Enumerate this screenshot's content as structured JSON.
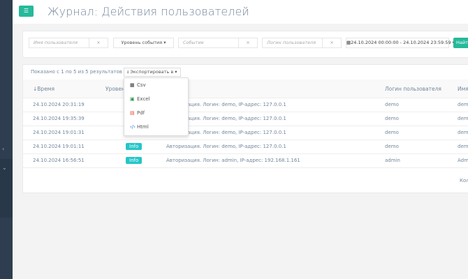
{
  "header": {
    "title": "Журнал: Действия пользователей",
    "menu_icon": "hamburger-icon"
  },
  "filters": {
    "username_placeholder": "Имя пользователя",
    "clear_label": "×",
    "event_level_label": "Уровень события ▾",
    "event_placeholder": "Событие",
    "login_placeholder": "Логин пользователя",
    "date_range": "24.10.2024 00:00:00 - 24.10.2024 23:59:59 ▾",
    "find_label": "Найти"
  },
  "results": {
    "summary": "Показано с 1 по 5 из 5 результатов",
    "export_label": "Экспортировать в ▾",
    "export_menu": [
      {
        "label": "Csv",
        "icon": "table-icon"
      },
      {
        "label": "Excel",
        "icon": "file-excel-icon"
      },
      {
        "label": "Pdf",
        "icon": "file-pdf-icon"
      },
      {
        "label": "Html",
        "icon": "code-icon"
      }
    ],
    "columns": [
      "↓Время",
      "Уровень",
      "Логин пользователя",
      "Имя"
    ],
    "rows": [
      {
        "time": "24.10.2024 20:31:19",
        "level": "",
        "event": "Авторизация. Логин: demo, IP-адрес: 127.0.0.1",
        "login": "demo",
        "name": "demo"
      },
      {
        "time": "24.10.2024 19:35:39",
        "level": "",
        "event": "Авторизация. Логин: demo, IP-адрес: 127.0.0.1",
        "login": "demo",
        "name": "demo"
      },
      {
        "time": "24.10.2024 19:01:31",
        "level": "",
        "event": "Авторизация. Логин: demo, IP-адрес: 127.0.0.1",
        "login": "demo",
        "name": "demo"
      },
      {
        "time": "24.10.2024 19:01:11",
        "level": "Info",
        "event": "Авторизация. Логин: demo, IP-адрес: 127.0.0.1",
        "login": "demo",
        "name": "demo"
      },
      {
        "time": "24.10.2024 16:56:51",
        "level": "Info",
        "event": "Авторизация. Логин: admin, IP-адрес: 192.168.1.161",
        "login": "admin",
        "name": "Admin"
      }
    ],
    "footer": "Кол"
  },
  "colors": {
    "accent": "#26b99a",
    "info_badge": "#23c6c8",
    "sidebar": "#2e3e50"
  }
}
